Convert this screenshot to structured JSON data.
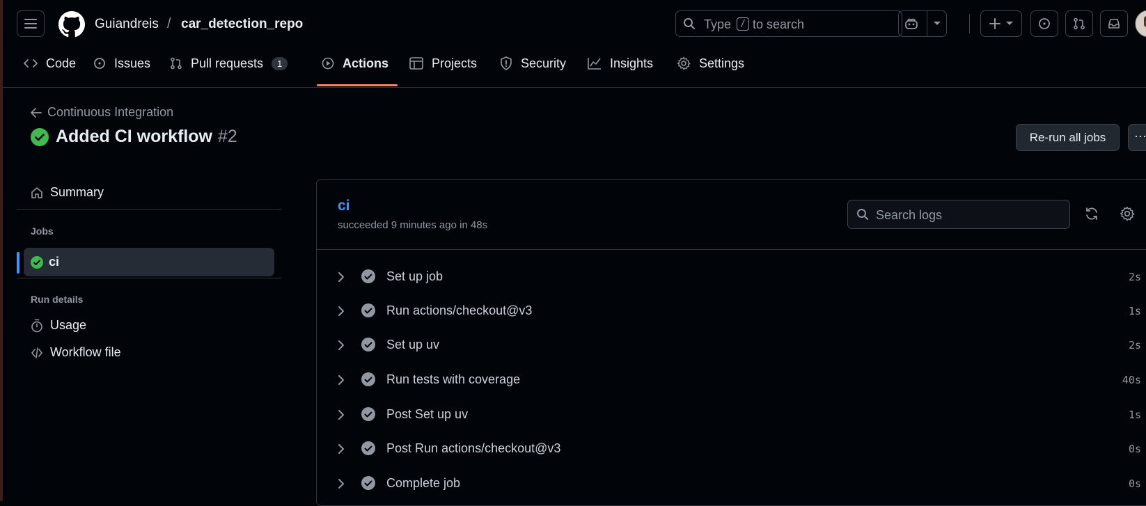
{
  "header": {
    "owner": "Guiandreis",
    "separator": "/",
    "repo": "car_detection_repo",
    "search": {
      "prefix": "Type",
      "key": "/",
      "suffix": "to search"
    }
  },
  "tabs": [
    {
      "label": "Code",
      "icon": "code-icon"
    },
    {
      "label": "Issues",
      "icon": "issue-icon"
    },
    {
      "label": "Pull requests",
      "icon": "pull-request-icon",
      "count": "1"
    },
    {
      "label": "Actions",
      "icon": "play-icon",
      "active": true
    },
    {
      "label": "Projects",
      "icon": "table-icon"
    },
    {
      "label": "Security",
      "icon": "shield-icon"
    },
    {
      "label": "Insights",
      "icon": "graph-icon"
    },
    {
      "label": "Settings",
      "icon": "gear-icon"
    }
  ],
  "run": {
    "workflow": "Continuous Integration",
    "title": "Added CI workflow",
    "number": "#2",
    "rerun_label": "Re-run all jobs",
    "more_label": "···"
  },
  "sidebar": {
    "summary": "Summary",
    "jobs_heading": "Jobs",
    "job": "ci",
    "run_details_heading": "Run details",
    "usage": "Usage",
    "workflow_file": "Workflow file"
  },
  "job": {
    "name": "ci",
    "status": "succeeded 9 minutes ago in 48s",
    "search_placeholder": "Search logs",
    "steps": [
      {
        "name": "Set up job",
        "duration": "2s"
      },
      {
        "name": "Run actions/checkout@v3",
        "duration": "1s"
      },
      {
        "name": "Set up uv",
        "duration": "2s"
      },
      {
        "name": "Run tests with coverage",
        "duration": "40s"
      },
      {
        "name": "Post Set up uv",
        "duration": "1s"
      },
      {
        "name": "Post Run actions/checkout@v3",
        "duration": "0s"
      },
      {
        "name": "Complete job",
        "duration": "0s"
      }
    ]
  },
  "colors": {
    "background": "#010409",
    "success": "#3fb950",
    "link": "#4493f8",
    "active_tab_underline": "#f78166"
  }
}
